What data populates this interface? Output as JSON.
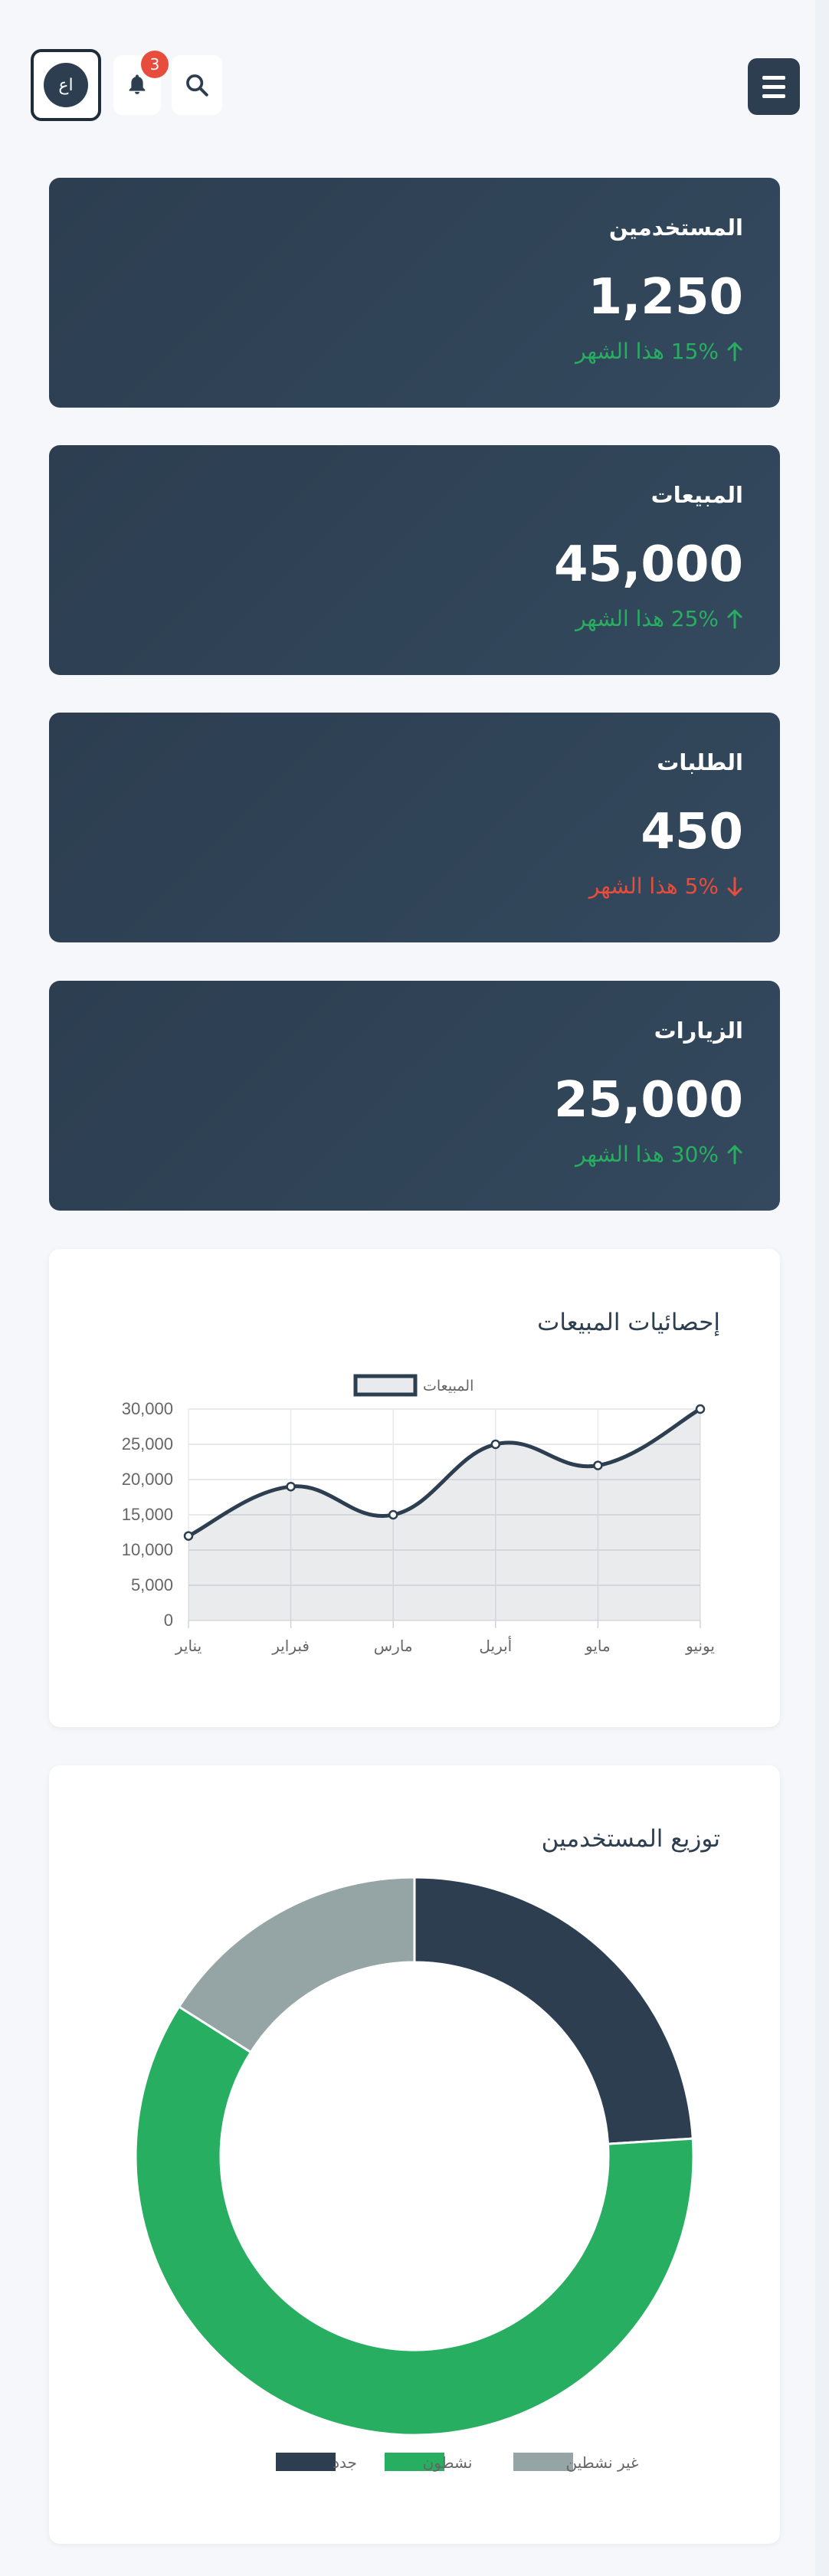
{
  "header": {
    "menu_icon": "hamburger-icon",
    "notifications_icon": "bell-icon",
    "notifications_count": "3",
    "search_icon": "search-icon",
    "avatar_initials": "اع"
  },
  "stats": [
    {
      "title": "المستخدمين",
      "value": "1,250",
      "change": "15% هذا الشهر",
      "trend": "up"
    },
    {
      "title": "المبيعات",
      "value": "45,000",
      "change": "25% هذا الشهر",
      "trend": "up"
    },
    {
      "title": "الطلبات",
      "value": "450",
      "change": "5% هذا الشهر",
      "trend": "down"
    },
    {
      "title": "الزيارات",
      "value": "25,000",
      "change": "30% هذا الشهر",
      "trend": "up"
    }
  ],
  "colors": {
    "primary": "#2c3e50",
    "success": "#27ae60",
    "danger": "#e74c3c",
    "muted": "#95a5a6"
  },
  "sales_chart": {
    "title": "إحصائيات المبيعات",
    "chart_data": {
      "type": "line",
      "categories": [
        "يناير",
        "فبراير",
        "مارس",
        "أبريل",
        "مايو",
        "يونيو"
      ],
      "series": [
        {
          "name": "المبيعات",
          "values": [
            12000,
            19000,
            15000,
            25000,
            22000,
            30000
          ],
          "color": "#2c3e50"
        }
      ],
      "ylim": [
        0,
        30000
      ],
      "yticks": [
        "0",
        "5,000",
        "10,000",
        "15,000",
        "20,000",
        "25,000",
        "30,000"
      ],
      "legend": "top",
      "grid": true,
      "fill": true
    }
  },
  "users_chart": {
    "title": "توزيع المستخدمين",
    "chart_data": {
      "type": "pie",
      "donut": true,
      "slices": [
        {
          "name": "جدد",
          "value": 300,
          "color": "#2c3e50"
        },
        {
          "name": "نشطون",
          "value": 750,
          "color": "#27ae60"
        },
        {
          "name": "غير نشطين",
          "value": 200,
          "color": "#95a5a6"
        }
      ],
      "legend": "bottom"
    }
  }
}
